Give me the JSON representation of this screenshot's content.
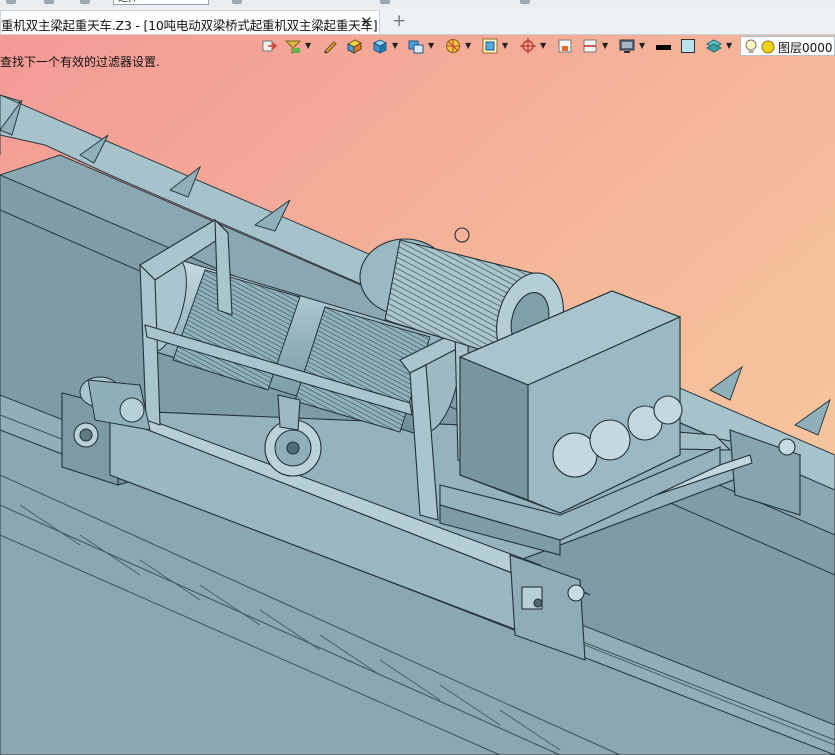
{
  "window": {
    "quick_access_input": "选择"
  },
  "tab": {
    "title": "重机双主梁起重天车.Z3 - [10吨电动双梁桥式起重机双主梁起重天车]",
    "close_glyph": "✕",
    "add_glyph": "+"
  },
  "toolbar": {
    "icons": [
      "exit-icon",
      "filter-icon",
      "pencil-icon",
      "shading-icon",
      "cube-icon",
      "view-cube-icon",
      "render-mode-icon",
      "fit-view-icon",
      "snap-target-icon",
      "plane-icon",
      "section-icon",
      "display-icon",
      "line-color-swatch",
      "fill-color-swatch",
      "layer-stack-icon",
      "bulb-icon",
      "sun-icon"
    ],
    "line_color": "#000000",
    "fill_color": "#b9e3ef",
    "layer_label": "图层0000"
  },
  "viewport": {
    "status_message": "查找下一个有效的过滤器设置.",
    "background_top_left": "#f4a29a",
    "background_right": "#f6c09a",
    "model_color": "#8fb1bb"
  }
}
